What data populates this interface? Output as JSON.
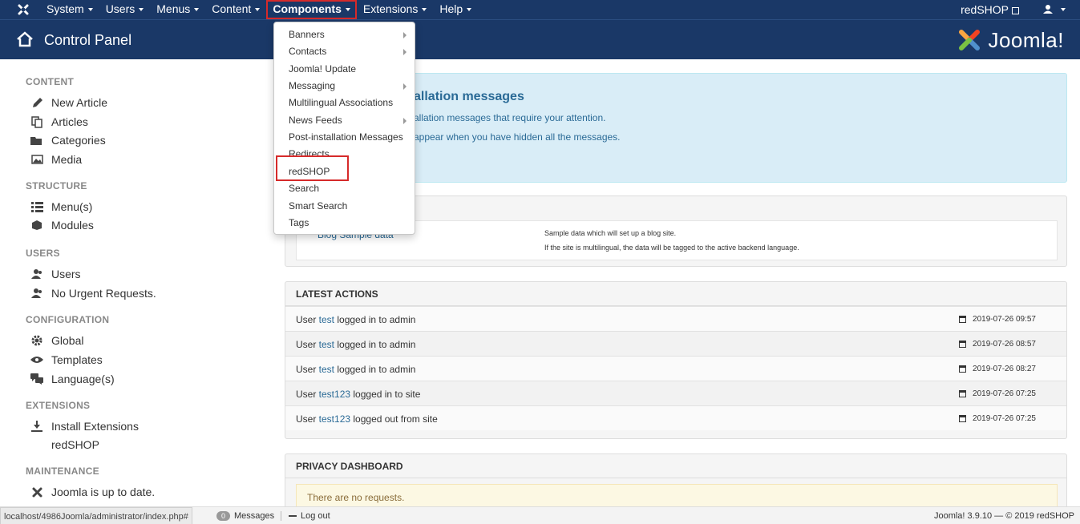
{
  "navbar": {
    "menu": [
      {
        "label": "System"
      },
      {
        "label": "Users"
      },
      {
        "label": "Menus"
      },
      {
        "label": "Content"
      },
      {
        "label": "Components"
      },
      {
        "label": "Extensions"
      },
      {
        "label": "Help"
      }
    ],
    "site_link": "redSHOP",
    "brand_icon": "joomla-icon",
    "user_icon": "user-icon"
  },
  "header": {
    "title": "Control Panel",
    "logo_text": "Joomla!",
    "home_icon": "home-icon"
  },
  "sidebar": {
    "sections": [
      {
        "title": "CONTENT",
        "items": [
          {
            "label": "New Article",
            "icon": "pencil-icon"
          },
          {
            "label": "Articles",
            "icon": "copy-icon"
          },
          {
            "label": "Categories",
            "icon": "folder-open-icon"
          },
          {
            "label": "Media",
            "icon": "image-icon"
          }
        ]
      },
      {
        "title": "STRUCTURE",
        "items": [
          {
            "label": "Menu(s)",
            "icon": "list-icon"
          },
          {
            "label": "Modules",
            "icon": "cube-icon"
          }
        ]
      },
      {
        "title": "USERS",
        "items": [
          {
            "label": "Users",
            "icon": "users-icon"
          },
          {
            "label": "No Urgent Requests.",
            "icon": "users-icon"
          }
        ]
      },
      {
        "title": "CONFIGURATION",
        "items": [
          {
            "label": "Global",
            "icon": "cog-icon"
          },
          {
            "label": "Templates",
            "icon": "eye-icon"
          },
          {
            "label": "Language(s)",
            "icon": "comments-icon"
          }
        ]
      },
      {
        "title": "EXTENSIONS",
        "items": [
          {
            "label": "Install Extensions",
            "icon": "download-icon"
          },
          {
            "label": "redSHOP",
            "icon": ""
          }
        ]
      },
      {
        "title": "MAINTENANCE",
        "items": [
          {
            "label": "Joomla is up to date.",
            "icon": "joomla-icon"
          }
        ]
      }
    ]
  },
  "postinstall": {
    "heading": "allation messages",
    "line1": "allation messages that require your attention.",
    "line2": "appear when you have hidden all the messages."
  },
  "sample_data": {
    "link": "Blog Sample data",
    "desc1": "Sample data which will set up a blog site.",
    "desc2": "If the site is multilingual, the data will be tagged to the active backend language."
  },
  "latest_actions": {
    "title": "LATEST ACTIONS",
    "rows": [
      {
        "pre": "User ",
        "user": "test",
        "post": " logged in to admin",
        "date": "2019-07-26 09:57"
      },
      {
        "pre": "User ",
        "user": "test",
        "post": " logged in to admin",
        "date": "2019-07-26 08:57"
      },
      {
        "pre": "User ",
        "user": "test",
        "post": " logged in to admin",
        "date": "2019-07-26 08:27"
      },
      {
        "pre": "User ",
        "user": "test123",
        "post": " logged in to site",
        "date": "2019-07-26 07:25"
      },
      {
        "pre": "User ",
        "user": "test123",
        "post": " logged out from site",
        "date": "2019-07-26 07:25"
      }
    ]
  },
  "privacy": {
    "title": "PRIVACY DASHBOARD",
    "message": "There are no requests."
  },
  "components_menu": {
    "items": [
      {
        "label": "Banners",
        "submenu": true
      },
      {
        "label": "Contacts",
        "submenu": true
      },
      {
        "label": "Joomla! Update",
        "submenu": false
      },
      {
        "label": "Messaging",
        "submenu": true
      },
      {
        "label": "Multilingual Associations",
        "submenu": false
      },
      {
        "label": "News Feeds",
        "submenu": true
      },
      {
        "label": "Post-installation Messages",
        "submenu": false
      },
      {
        "label": "Redirects",
        "submenu": false
      },
      {
        "label": "redSHOP",
        "submenu": false
      },
      {
        "label": "Search",
        "submenu": false
      },
      {
        "label": "Smart Search",
        "submenu": false
      },
      {
        "label": "Tags",
        "submenu": false
      }
    ]
  },
  "statusbar": {
    "url": "localhost/4986Joomla/administrator/index.php#",
    "messages_count": "0",
    "messages_label": "Messages",
    "logout": "Log out",
    "copyright": "Joomla! 3.9.10 — © 2019 redSHOP"
  },
  "colors": {
    "navbar": "#1a3867",
    "highlight": "#d62a2a",
    "link": "#2a6a96",
    "info_bg": "#d9edf7"
  }
}
